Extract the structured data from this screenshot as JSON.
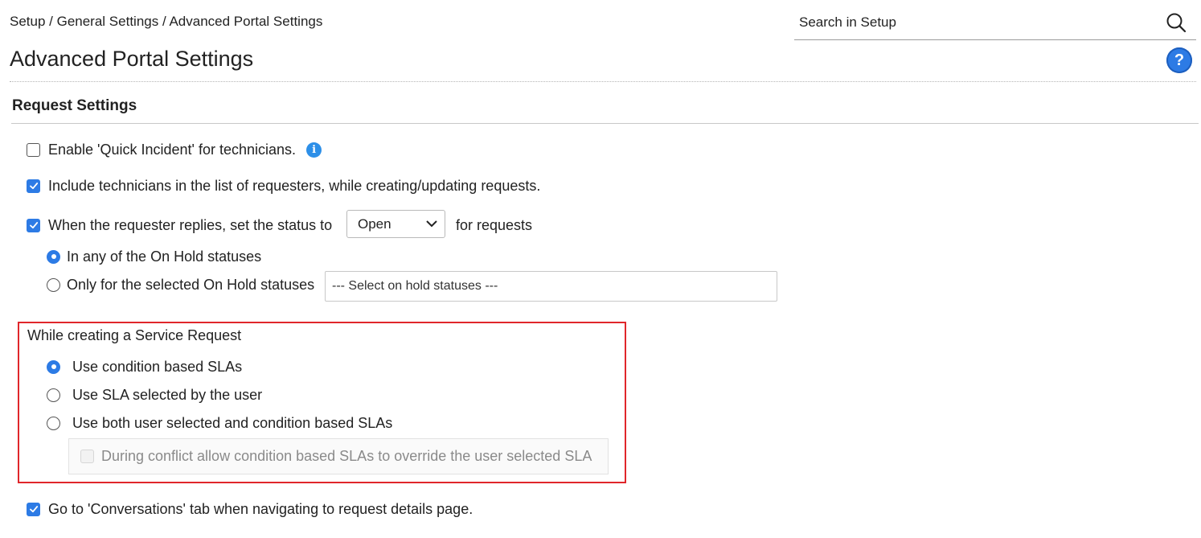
{
  "breadcrumb": "Setup / General Settings / Advanced Portal Settings",
  "search": {
    "placeholder": "Search in Setup"
  },
  "page_title": "Advanced Portal Settings",
  "help_label": "?",
  "section_title": "Request Settings",
  "options": {
    "quick_incident": {
      "label": "Enable 'Quick Incident' for technicians.",
      "checked": false
    },
    "include_technicians": {
      "label": "Include technicians in the list of requesters, while creating/updating requests.",
      "checked": true
    },
    "requester_replies": {
      "label_before": "When the requester replies, set the status to",
      "status_value": "Open",
      "label_after": "for requests",
      "checked": true,
      "scope_any": "In any of the On Hold statuses",
      "scope_selected": "Only for the selected On Hold statuses",
      "hold_status_placeholder": "--- Select on hold statuses ---"
    },
    "service_request": {
      "title": "While creating a Service Request",
      "opt_condition": "Use condition based SLAs",
      "opt_user": "Use SLA selected by the user",
      "opt_both": "Use both user selected and condition based SLAs",
      "conflict": "During conflict allow condition based SLAs to override the user selected SLA"
    },
    "conversations_tab": {
      "label": "Go to 'Conversations' tab when navigating to request details page.",
      "checked": true
    }
  },
  "colors": {
    "accent": "#2d7be5",
    "highlight_border": "#e0262b"
  }
}
